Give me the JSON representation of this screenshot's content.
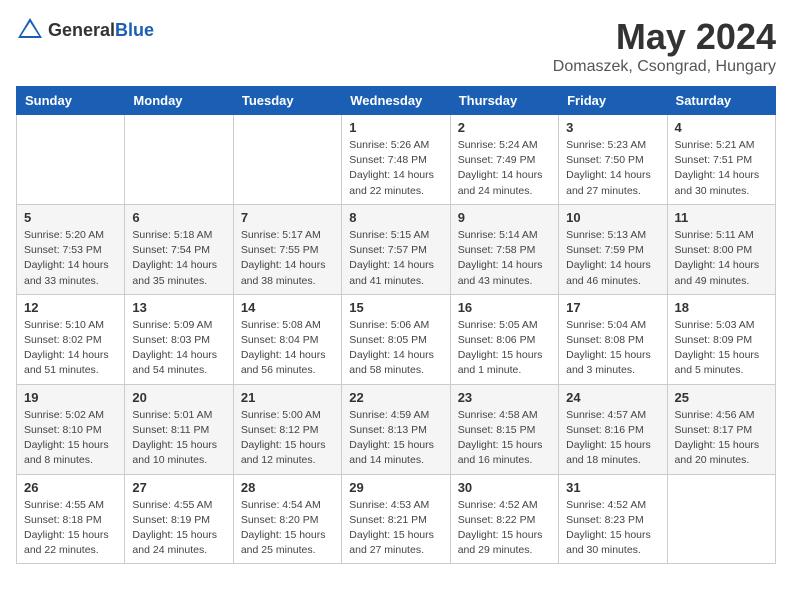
{
  "header": {
    "logo_general": "General",
    "logo_blue": "Blue",
    "month": "May 2024",
    "location": "Domaszek, Csongrad, Hungary"
  },
  "weekdays": [
    "Sunday",
    "Monday",
    "Tuesday",
    "Wednesday",
    "Thursday",
    "Friday",
    "Saturday"
  ],
  "weeks": [
    [
      {
        "day": "",
        "info": ""
      },
      {
        "day": "",
        "info": ""
      },
      {
        "day": "",
        "info": ""
      },
      {
        "day": "1",
        "info": "Sunrise: 5:26 AM\nSunset: 7:48 PM\nDaylight: 14 hours\nand 22 minutes."
      },
      {
        "day": "2",
        "info": "Sunrise: 5:24 AM\nSunset: 7:49 PM\nDaylight: 14 hours\nand 24 minutes."
      },
      {
        "day": "3",
        "info": "Sunrise: 5:23 AM\nSunset: 7:50 PM\nDaylight: 14 hours\nand 27 minutes."
      },
      {
        "day": "4",
        "info": "Sunrise: 5:21 AM\nSunset: 7:51 PM\nDaylight: 14 hours\nand 30 minutes."
      }
    ],
    [
      {
        "day": "5",
        "info": "Sunrise: 5:20 AM\nSunset: 7:53 PM\nDaylight: 14 hours\nand 33 minutes."
      },
      {
        "day": "6",
        "info": "Sunrise: 5:18 AM\nSunset: 7:54 PM\nDaylight: 14 hours\nand 35 minutes."
      },
      {
        "day": "7",
        "info": "Sunrise: 5:17 AM\nSunset: 7:55 PM\nDaylight: 14 hours\nand 38 minutes."
      },
      {
        "day": "8",
        "info": "Sunrise: 5:15 AM\nSunset: 7:57 PM\nDaylight: 14 hours\nand 41 minutes."
      },
      {
        "day": "9",
        "info": "Sunrise: 5:14 AM\nSunset: 7:58 PM\nDaylight: 14 hours\nand 43 minutes."
      },
      {
        "day": "10",
        "info": "Sunrise: 5:13 AM\nSunset: 7:59 PM\nDaylight: 14 hours\nand 46 minutes."
      },
      {
        "day": "11",
        "info": "Sunrise: 5:11 AM\nSunset: 8:00 PM\nDaylight: 14 hours\nand 49 minutes."
      }
    ],
    [
      {
        "day": "12",
        "info": "Sunrise: 5:10 AM\nSunset: 8:02 PM\nDaylight: 14 hours\nand 51 minutes."
      },
      {
        "day": "13",
        "info": "Sunrise: 5:09 AM\nSunset: 8:03 PM\nDaylight: 14 hours\nand 54 minutes."
      },
      {
        "day": "14",
        "info": "Sunrise: 5:08 AM\nSunset: 8:04 PM\nDaylight: 14 hours\nand 56 minutes."
      },
      {
        "day": "15",
        "info": "Sunrise: 5:06 AM\nSunset: 8:05 PM\nDaylight: 14 hours\nand 58 minutes."
      },
      {
        "day": "16",
        "info": "Sunrise: 5:05 AM\nSunset: 8:06 PM\nDaylight: 15 hours\nand 1 minute."
      },
      {
        "day": "17",
        "info": "Sunrise: 5:04 AM\nSunset: 8:08 PM\nDaylight: 15 hours\nand 3 minutes."
      },
      {
        "day": "18",
        "info": "Sunrise: 5:03 AM\nSunset: 8:09 PM\nDaylight: 15 hours\nand 5 minutes."
      }
    ],
    [
      {
        "day": "19",
        "info": "Sunrise: 5:02 AM\nSunset: 8:10 PM\nDaylight: 15 hours\nand 8 minutes."
      },
      {
        "day": "20",
        "info": "Sunrise: 5:01 AM\nSunset: 8:11 PM\nDaylight: 15 hours\nand 10 minutes."
      },
      {
        "day": "21",
        "info": "Sunrise: 5:00 AM\nSunset: 8:12 PM\nDaylight: 15 hours\nand 12 minutes."
      },
      {
        "day": "22",
        "info": "Sunrise: 4:59 AM\nSunset: 8:13 PM\nDaylight: 15 hours\nand 14 minutes."
      },
      {
        "day": "23",
        "info": "Sunrise: 4:58 AM\nSunset: 8:15 PM\nDaylight: 15 hours\nand 16 minutes."
      },
      {
        "day": "24",
        "info": "Sunrise: 4:57 AM\nSunset: 8:16 PM\nDaylight: 15 hours\nand 18 minutes."
      },
      {
        "day": "25",
        "info": "Sunrise: 4:56 AM\nSunset: 8:17 PM\nDaylight: 15 hours\nand 20 minutes."
      }
    ],
    [
      {
        "day": "26",
        "info": "Sunrise: 4:55 AM\nSunset: 8:18 PM\nDaylight: 15 hours\nand 22 minutes."
      },
      {
        "day": "27",
        "info": "Sunrise: 4:55 AM\nSunset: 8:19 PM\nDaylight: 15 hours\nand 24 minutes."
      },
      {
        "day": "28",
        "info": "Sunrise: 4:54 AM\nSunset: 8:20 PM\nDaylight: 15 hours\nand 25 minutes."
      },
      {
        "day": "29",
        "info": "Sunrise: 4:53 AM\nSunset: 8:21 PM\nDaylight: 15 hours\nand 27 minutes."
      },
      {
        "day": "30",
        "info": "Sunrise: 4:52 AM\nSunset: 8:22 PM\nDaylight: 15 hours\nand 29 minutes."
      },
      {
        "day": "31",
        "info": "Sunrise: 4:52 AM\nSunset: 8:23 PM\nDaylight: 15 hours\nand 30 minutes."
      },
      {
        "day": "",
        "info": ""
      }
    ]
  ]
}
